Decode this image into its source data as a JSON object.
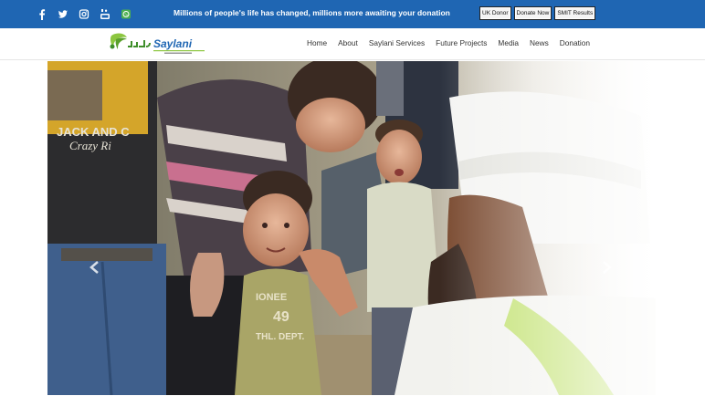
{
  "social": {
    "icons": [
      "facebook-icon",
      "twitter-icon",
      "instagram-icon",
      "youtube-icon",
      "whatsapp-icon"
    ]
  },
  "topbar": {
    "tagline": "Millions of people's life has changed, millions more awaiting your donation",
    "buttons": [
      "UK Donor",
      "Donate Now",
      "SMIT Results"
    ],
    "bg_color": "#1f66b3"
  },
  "logo": {
    "text": "Saylani",
    "urdu_text": "سیلانی"
  },
  "nav": {
    "items": [
      "Home",
      "About",
      "Saylani Services",
      "Future Projects",
      "Media",
      "News",
      "Donation"
    ]
  },
  "hero": {
    "shirt_text_1": "JACK AND C",
    "shirt_text_2": "Crazy Ri",
    "shirt_text_3": "IONEE",
    "shirt_text_4": "49",
    "shirt_text_5": "THL. DEPT."
  }
}
